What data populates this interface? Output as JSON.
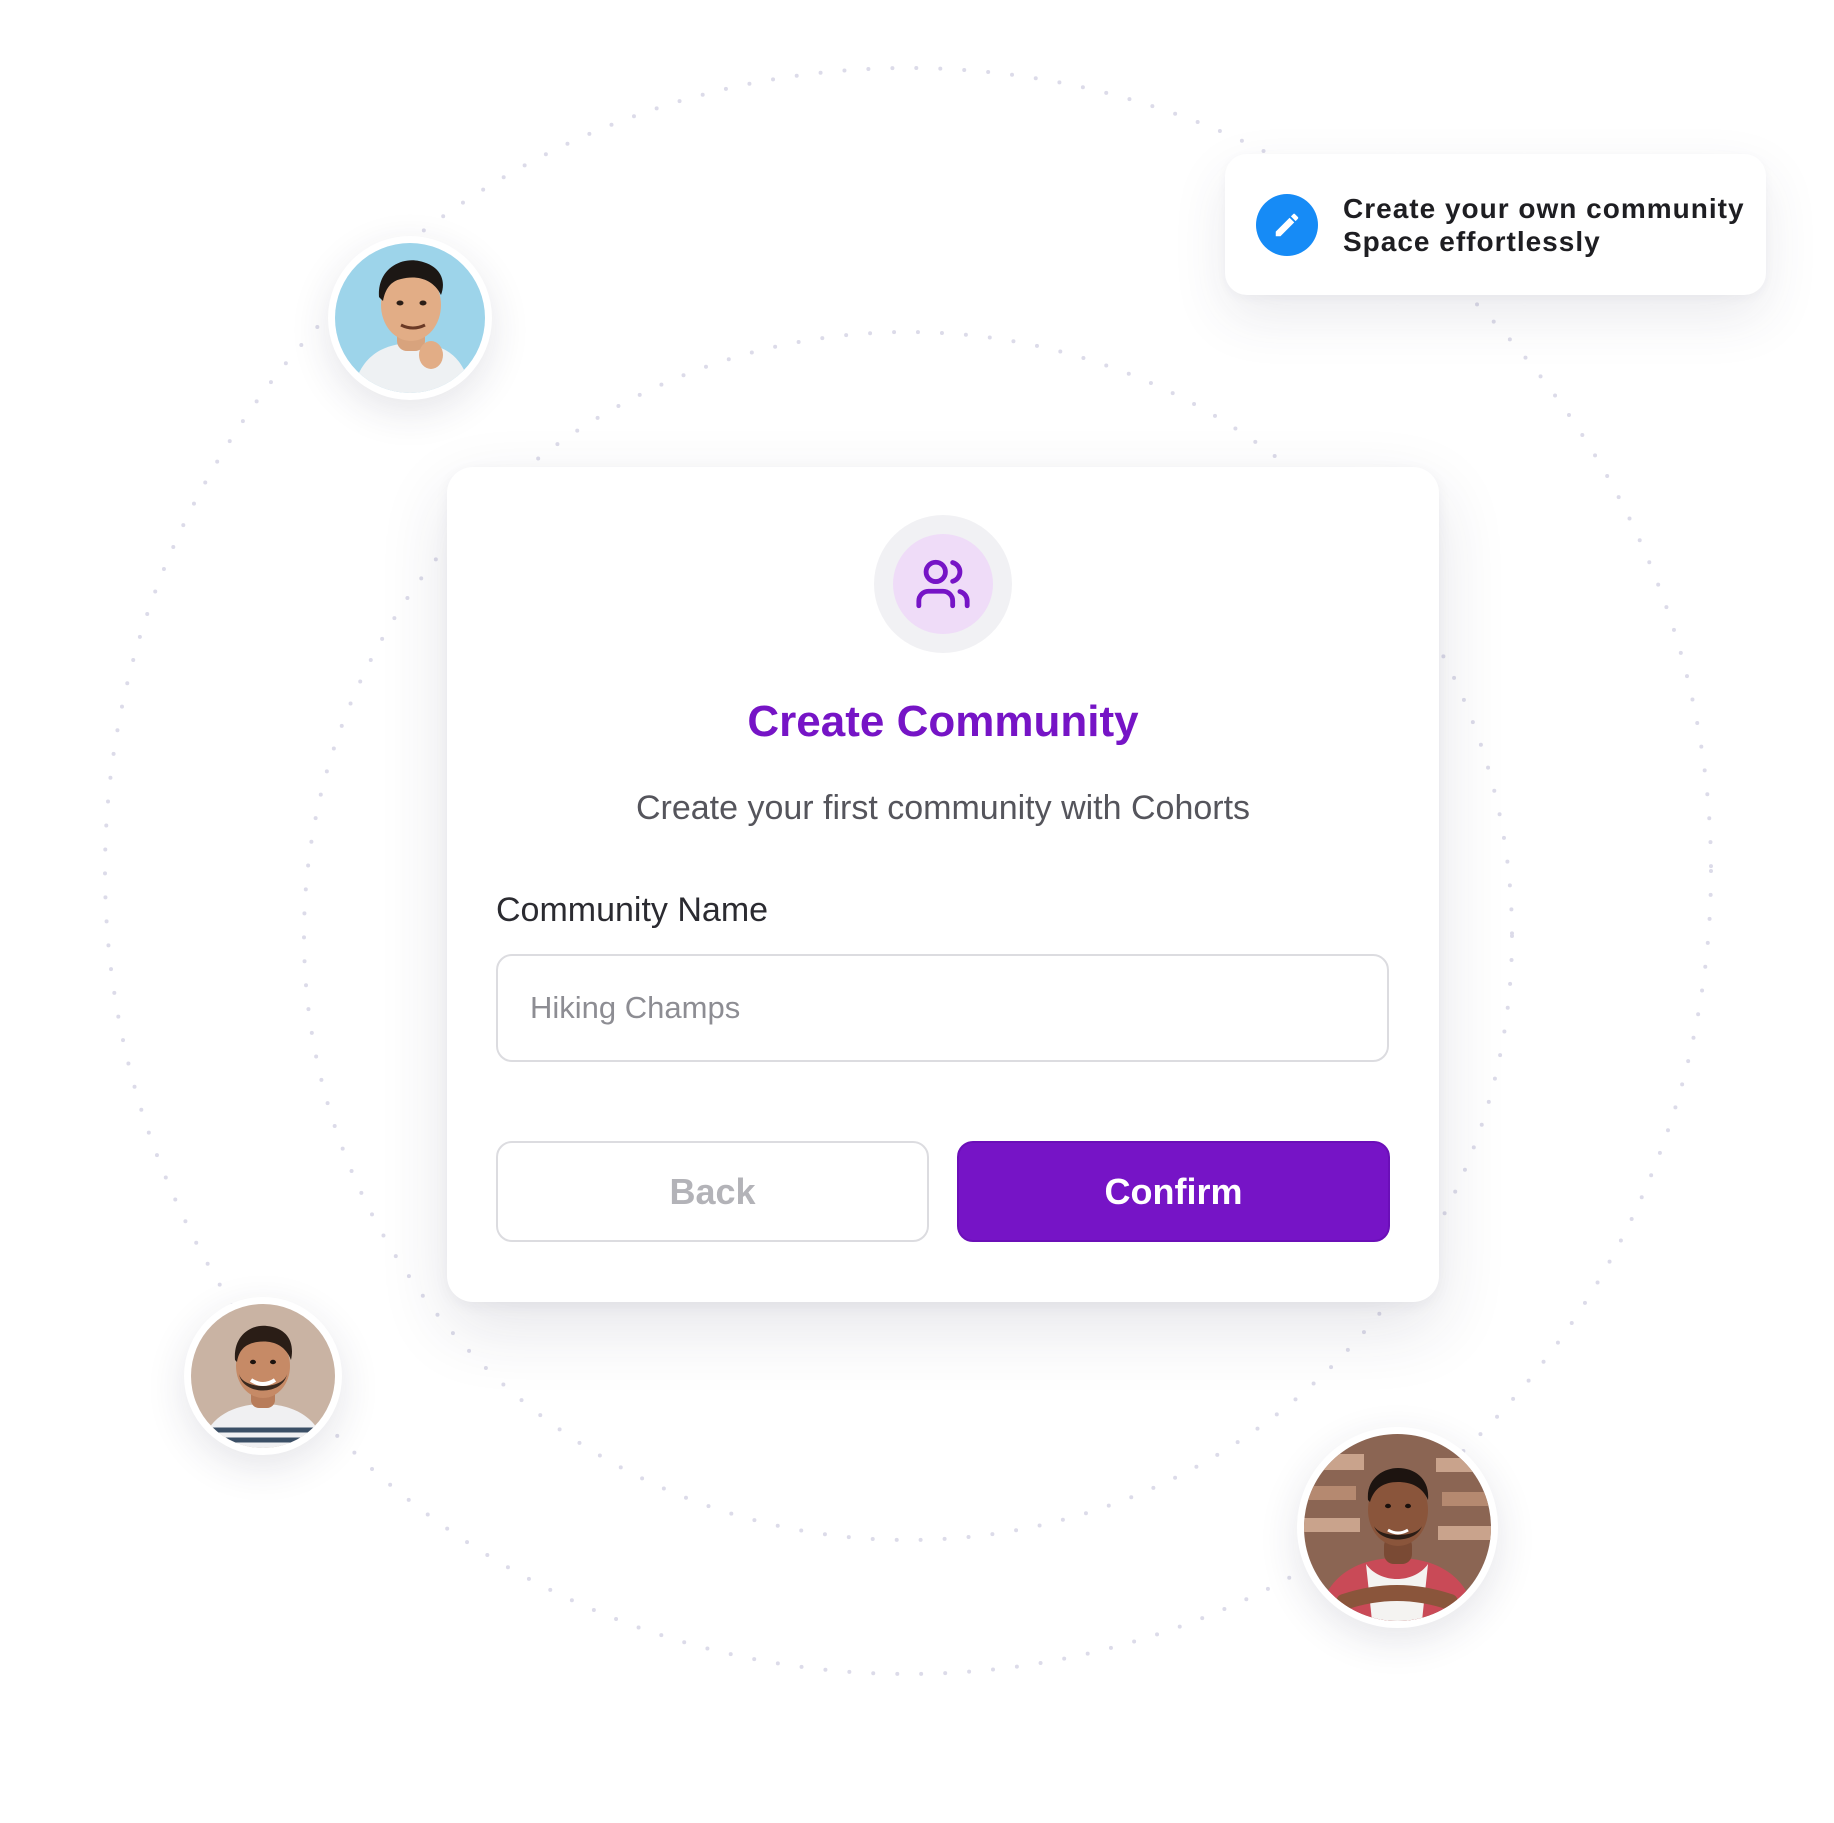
{
  "toast": {
    "line1": "Create your own community",
    "line2": "Space effortlessly",
    "icon": "pencil-icon",
    "icon_bg": "#168bf6"
  },
  "dialog": {
    "icon": "users-icon",
    "title": "Create Community",
    "subtitle": "Create your first community with Cohorts",
    "field_label": "Community Name",
    "field_placeholder": "Hiking Champs",
    "field_value": "",
    "back_label": "Back",
    "confirm_label": "Confirm"
  },
  "colors": {
    "accent": "#7614c6",
    "badge_bg": "#efdcf8",
    "orbit_dots": "#dcdbe9"
  },
  "avatars": [
    {
      "name": "man-light-blue-background"
    },
    {
      "name": "smiling-man-beige-background"
    },
    {
      "name": "man-in-apron-workshop"
    }
  ]
}
